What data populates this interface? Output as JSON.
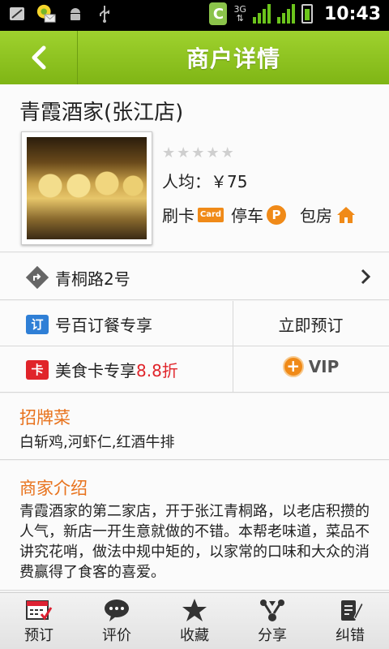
{
  "status_bar": {
    "time": "10:43",
    "network_type": "3G",
    "icons": [
      "sim-icon",
      "notification-icon",
      "android-icon",
      "usb-icon",
      "c-app-icon",
      "3g-signal-icon",
      "battery-icon"
    ],
    "c_badge": "C"
  },
  "header": {
    "title": "商户详情"
  },
  "merchant": {
    "name": "青霞酒家(张江店)",
    "rating_stars": 0,
    "rating_max": 5,
    "avg_price": "人均：￥75",
    "features": [
      {
        "label": "刷卡",
        "icon": "card-icon",
        "icon_text": "Card"
      },
      {
        "label": "停车",
        "icon": "parking-icon",
        "icon_text": "P"
      },
      {
        "label": "包房",
        "icon": "house-icon"
      }
    ]
  },
  "address": {
    "text": "青桐路2号"
  },
  "offers": {
    "booking": {
      "tag": "订",
      "label": "号百订餐专享",
      "action": "立即预订"
    },
    "card": {
      "tag": "卡",
      "label": "美食卡专享",
      "discount": "8.8折",
      "action": "VIP"
    }
  },
  "signature": {
    "heading": "招牌菜",
    "text": "白斩鸡,河虾仁,红酒牛排"
  },
  "intro": {
    "heading": "商家介绍",
    "text": "青霞酒家的第二家店，开于张江青桐路，以老店积攒的人气，新店一开生意就做的不错。本帮老味道，菜品不讲究花哨，做法中规中矩的，以家常的口味和大众的消费赢得了食客的喜爱。"
  },
  "tabs": [
    {
      "label": "预订",
      "icon": "booking-icon"
    },
    {
      "label": "评价",
      "icon": "comment-icon"
    },
    {
      "label": "收藏",
      "icon": "star-icon"
    },
    {
      "label": "分享",
      "icon": "share-icon"
    },
    {
      "label": "纠错",
      "icon": "edit-icon"
    }
  ],
  "colors": {
    "title_green": "#8cc21f",
    "accent_orange": "#e8721c",
    "discount_red": "#e0242a",
    "booking_blue": "#2f7fd6"
  }
}
